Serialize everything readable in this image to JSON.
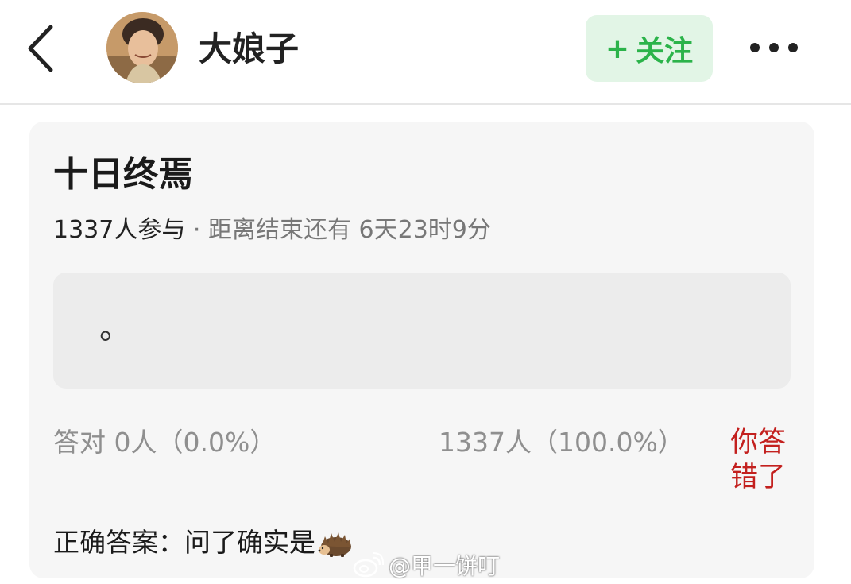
{
  "header": {
    "username": "大娘子",
    "follow_label": "关注",
    "follow_plus": "+",
    "back_icon": "chevron-left-icon",
    "more_icon": "more-horizontal-icon"
  },
  "quiz": {
    "title": "十日终焉",
    "participants": "1337人参与",
    "separator": "·",
    "countdown": "距离结束还有 6天23时9分",
    "question": "。",
    "correct_stat": "答对  0人（0.0%）",
    "wrong_stat": "1337人（100.0%）",
    "your_result": "你答错了",
    "answer": "正确答案：问了确实是"
  },
  "watermark": {
    "text": "@甲一饼叮"
  },
  "colors": {
    "follow_green": "#2bb34a",
    "follow_bg": "#e2f5e6",
    "wrong_red": "#c3201e",
    "card_bg": "#f6f6f6"
  }
}
